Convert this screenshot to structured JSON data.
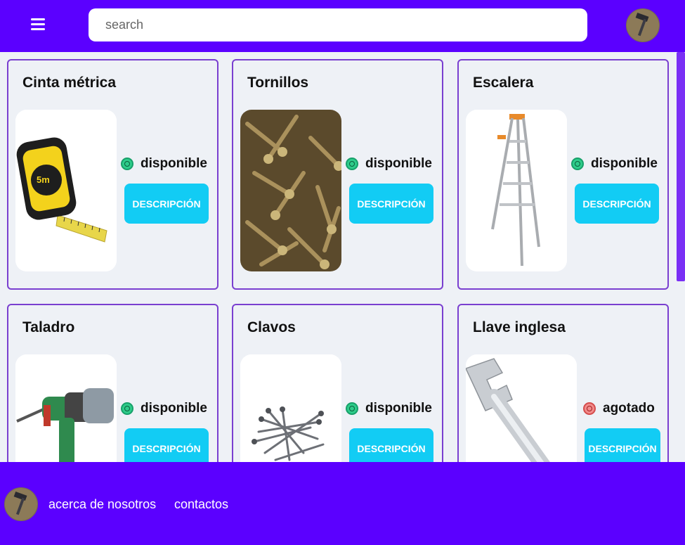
{
  "header": {
    "search_placeholder": "search"
  },
  "products": [
    {
      "name": "Cinta métrica",
      "status": "disponible",
      "status_color": "#2ecc8a",
      "image_icon": "tape-measure",
      "button_label": "DESCRIPCIÓN"
    },
    {
      "name": "Tornillos",
      "status": "disponible",
      "status_color": "#2ecc8a",
      "image_icon": "screws",
      "button_label": "DESCRIPCIÓN"
    },
    {
      "name": "Escalera",
      "status": "disponible",
      "status_color": "#2ecc8a",
      "image_icon": "ladder",
      "button_label": "DESCRIPCIÓN"
    },
    {
      "name": "Taladro",
      "status": "disponible",
      "status_color": "#2ecc8a",
      "image_icon": "drill",
      "button_label": "DESCRIPCIÓN"
    },
    {
      "name": "Clavos",
      "status": "disponible",
      "status_color": "#2ecc8a",
      "image_icon": "nails",
      "button_label": "DESCRIPCIÓN"
    },
    {
      "name": "Llave inglesa",
      "status": "agotado",
      "status_color": "#f28b8b",
      "image_icon": "wrench",
      "button_label": "DESCRIPCIÓN"
    }
  ],
  "footer": {
    "links": [
      "acerca de nosotros",
      "contactos"
    ]
  },
  "colors": {
    "brand": "#5b00ff",
    "button": "#12ccf4",
    "card_border": "#7a3fd0"
  }
}
